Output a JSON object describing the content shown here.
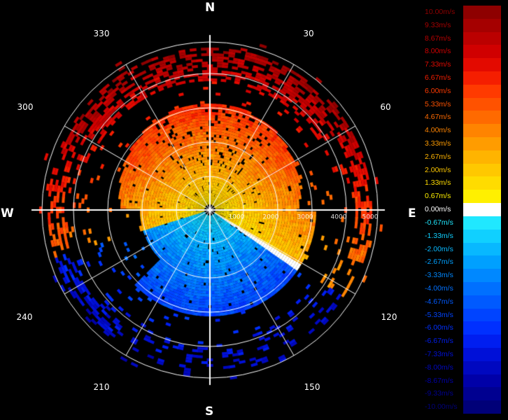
{
  "compass": {
    "north": "N",
    "south": "S",
    "east": "E",
    "west": "W"
  },
  "azimuth_labels": [
    "330",
    "30",
    "60",
    "300",
    "120",
    "240",
    "150",
    "210"
  ],
  "range_labels": [
    "1000",
    "2000",
    "3000",
    "4000",
    "5000"
  ],
  "legend": {
    "items": [
      {
        "label": "10.00m/s",
        "color": "#8e0000"
      },
      {
        "label": "9.33m/s",
        "color": "#a50000"
      },
      {
        "label": "8.67m/s",
        "color": "#bb0000"
      },
      {
        "label": "8.00m/s",
        "color": "#d00000"
      },
      {
        "label": "7.33m/s",
        "color": "#e30a00"
      },
      {
        "label": "6.67m/s",
        "color": "#f51e00"
      },
      {
        "label": "6.00m/s",
        "color": "#ff3a00"
      },
      {
        "label": "5.33m/s",
        "color": "#ff5200"
      },
      {
        "label": "4.67m/s",
        "color": "#ff6a00"
      },
      {
        "label": "4.00m/s",
        "color": "#ff8400"
      },
      {
        "label": "3.33m/s",
        "color": "#ff9c00"
      },
      {
        "label": "2.67m/s",
        "color": "#ffb400"
      },
      {
        "label": "2.00m/s",
        "color": "#ffc800"
      },
      {
        "label": "1.33m/s",
        "color": "#ffdc00"
      },
      {
        "label": "0.67m/s",
        "color": "#fff000"
      },
      {
        "label": "0.00m/s",
        "color": "#ffffff"
      },
      {
        "label": "-0.67m/s",
        "color": "#20e8ff"
      },
      {
        "label": "-1.33m/s",
        "color": "#10d0ff"
      },
      {
        "label": "-2.00m/s",
        "color": "#08b8ff"
      },
      {
        "label": "-2.67m/s",
        "color": "#00a0ff"
      },
      {
        "label": "-3.33m/s",
        "color": "#0088ff"
      },
      {
        "label": "-4.00m/s",
        "color": "#0070ff"
      },
      {
        "label": "-4.67m/s",
        "color": "#005aff"
      },
      {
        "label": "-5.33m/s",
        "color": "#0044ff"
      },
      {
        "label": "-6.00m/s",
        "color": "#0030ff"
      },
      {
        "label": "-6.67m/s",
        "color": "#001ef0"
      },
      {
        "label": "-7.33m/s",
        "color": "#0010d8"
      },
      {
        "label": "-8.00m/s",
        "color": "#0008c0"
      },
      {
        "label": "-8.67m/s",
        "color": "#0000a8"
      },
      {
        "label": "-9.33m/s",
        "color": "#000090"
      },
      {
        "label": "-10.00m/s",
        "color": "#000078"
      }
    ]
  }
}
